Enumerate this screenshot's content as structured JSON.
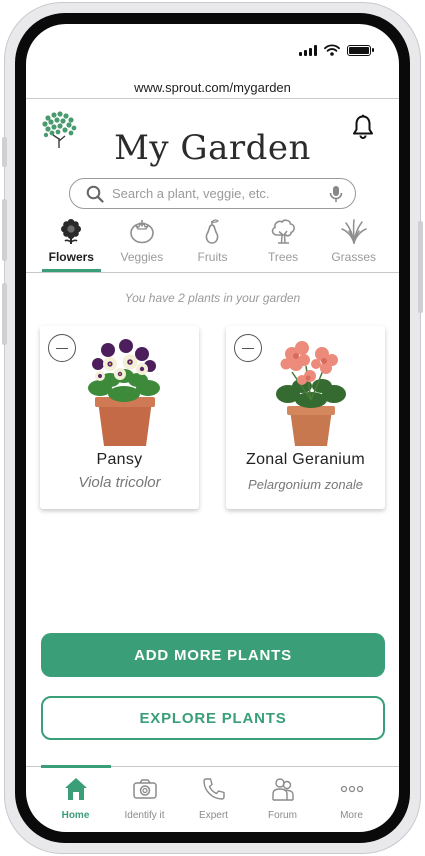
{
  "browser": {
    "url": "www.sprout.com/mygarden"
  },
  "header": {
    "title": "My Garden",
    "logo_icon": "tree-logo-icon",
    "notification_icon": "bell-icon"
  },
  "search": {
    "placeholder": "Search a plant, veggie, etc.",
    "value": ""
  },
  "tabs": [
    {
      "label": "Flowers",
      "icon": "flower-icon",
      "active": true
    },
    {
      "label": "Veggies",
      "icon": "tomato-icon",
      "active": false
    },
    {
      "label": "Fruits",
      "icon": "pear-icon",
      "active": false
    },
    {
      "label": "Trees",
      "icon": "tree-icon",
      "active": false
    },
    {
      "label": "Grasses",
      "icon": "grass-icon",
      "active": false
    }
  ],
  "garden": {
    "summary": "You have 2 plants in your garden",
    "plants": [
      {
        "name": "Pansy",
        "scientific_name": "Viola tricolor"
      },
      {
        "name": "Zonal Geranium",
        "scientific_name": "Pelargonium zonale"
      }
    ]
  },
  "actions": {
    "add_label": "ADD MORE PLANTS",
    "explore_label": "EXPLORE PLANTS"
  },
  "bottom_nav": [
    {
      "label": "Home",
      "icon": "home-icon",
      "active": true
    },
    {
      "label": "Identify it",
      "icon": "camera-icon",
      "active": false
    },
    {
      "label": "Expert",
      "icon": "phone-icon",
      "active": false
    },
    {
      "label": "Forum",
      "icon": "people-icon",
      "active": false
    },
    {
      "label": "More",
      "icon": "more-dots-icon",
      "active": false
    }
  ],
  "colors": {
    "accent": "#3a9e78",
    "text": "#222222",
    "muted": "#9a9a9a"
  }
}
